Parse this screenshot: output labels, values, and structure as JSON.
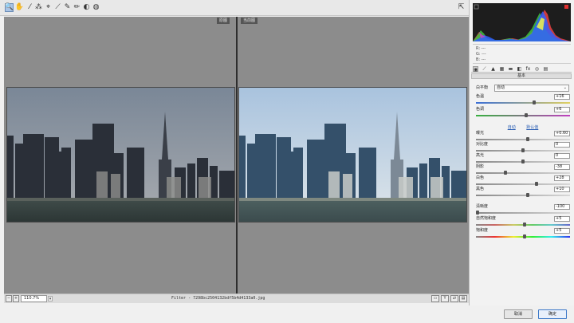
{
  "toolbar": {
    "tools": [
      {
        "name": "zoom-tool",
        "glyph": "🔍",
        "active": true
      },
      {
        "name": "hand-tool",
        "glyph": "✋"
      },
      {
        "name": "white-balance-tool",
        "glyph": "⁄"
      },
      {
        "name": "color-sampler-tool",
        "glyph": "⁂"
      },
      {
        "name": "targeted-adjustment-tool",
        "glyph": "⌖"
      },
      {
        "name": "straighten-tool",
        "glyph": "⟋"
      },
      {
        "name": "spot-removal-tool",
        "glyph": "✎"
      },
      {
        "name": "adjustment-brush-tool",
        "glyph": "✏"
      },
      {
        "name": "graduated-filter-tool",
        "glyph": "◐"
      },
      {
        "name": "radial-filter-tool",
        "glyph": "◍"
      }
    ],
    "fullscreen_glyph": "⇱"
  },
  "views": {
    "before_label": "原图",
    "after_label": "当前图"
  },
  "statusbar": {
    "zoom": "110.7%",
    "zoom_arrow": "▾",
    "filename": "Filter - 7298bc2504132bdf5b4d4133a0.jpg",
    "view_buttons": [
      "▭",
      "Y",
      "⇄",
      "▤"
    ]
  },
  "histogram_readout": {
    "r": "R:  ---",
    "g": "G:  ---",
    "b": "B:  ---"
  },
  "panel": {
    "tabs": [
      "◉",
      "⟋",
      "▲",
      "▦",
      "▬",
      "◧",
      "fx",
      "◎",
      "▤"
    ],
    "section_title": "基本",
    "white_balance_label": "白平衡",
    "white_balance_value": "自动",
    "auto_link": "自动",
    "default_link": "默认值",
    "sliders": [
      {
        "key": "temperature",
        "label": "色温",
        "value": "+16",
        "pos": 0.62,
        "track": "temp"
      },
      {
        "key": "tint",
        "label": "色调",
        "value": "+6",
        "pos": 0.53,
        "track": "tint"
      },
      {
        "key": "exposure",
        "label": "曝光",
        "value": "+0.60",
        "pos": 0.55,
        "track": "gray"
      },
      {
        "key": "contrast",
        "label": "对比度",
        "value": "0",
        "pos": 0.5,
        "track": "gray"
      },
      {
        "key": "highlights",
        "label": "高光",
        "value": "0",
        "pos": 0.5,
        "track": "gray"
      },
      {
        "key": "shadows",
        "label": "阴影",
        "value": "-38",
        "pos": 0.31,
        "track": "gray"
      },
      {
        "key": "whites",
        "label": "白色",
        "value": "+28",
        "pos": 0.64,
        "track": "gray"
      },
      {
        "key": "blacks",
        "label": "黑色",
        "value": "+10",
        "pos": 0.55,
        "track": "gray"
      },
      {
        "key": "clarity",
        "label": "清晰度",
        "value": "-100",
        "pos": 0.0,
        "track": "gray"
      },
      {
        "key": "vibrance",
        "label": "自然饱和度",
        "value": "+5",
        "pos": 0.52,
        "track": "vib"
      },
      {
        "key": "saturation",
        "label": "饱和度",
        "value": "+5",
        "pos": 0.52,
        "track": "sat"
      }
    ]
  },
  "dialog": {
    "cancel_label": "取消",
    "ok_label": "确定"
  }
}
